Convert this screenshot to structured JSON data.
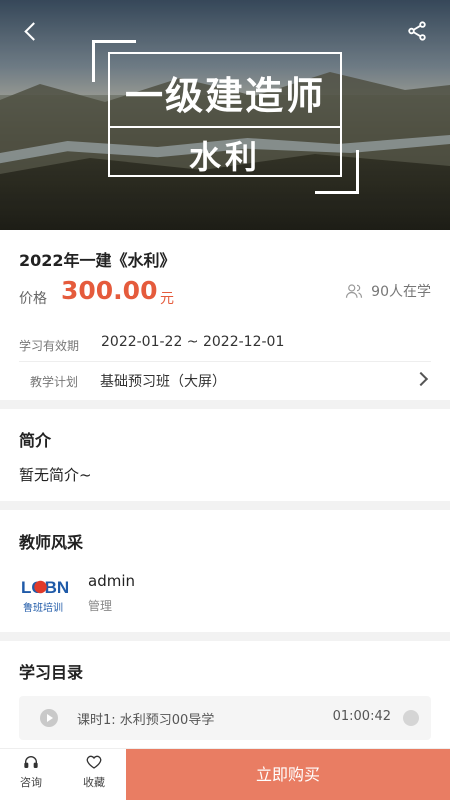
{
  "hero": {
    "title_line1": "一级建造师",
    "title_line2": "水利"
  },
  "course": {
    "title": "2022年一建《水利》",
    "price_label": "价格",
    "price_value": "300.00",
    "price_unit": "元",
    "learners": "90人在学",
    "validity_label": "学习有效期",
    "validity_value": "2022-01-22 ~ 2022-12-01",
    "plan_label": "教学计划",
    "plan_value": "基础预习班（大屏）"
  },
  "intro": {
    "title": "简介",
    "text": "暂无简介~"
  },
  "teacher": {
    "title": "教师风采",
    "name": "admin",
    "role": "管理",
    "logo_text": "LOBN",
    "logo_subtext": "鲁班培训"
  },
  "catalog": {
    "title": "学习目录",
    "lessons": [
      {
        "title": "课时1: 水利预习00导学",
        "duration": "01:00:42"
      }
    ]
  },
  "bottom_bar": {
    "consult_label": "咨询",
    "favorite_label": "收藏",
    "buy_label": "立即购买"
  },
  "colors": {
    "accent_price": "#e55b3c",
    "buy_button": "#e97d63"
  }
}
